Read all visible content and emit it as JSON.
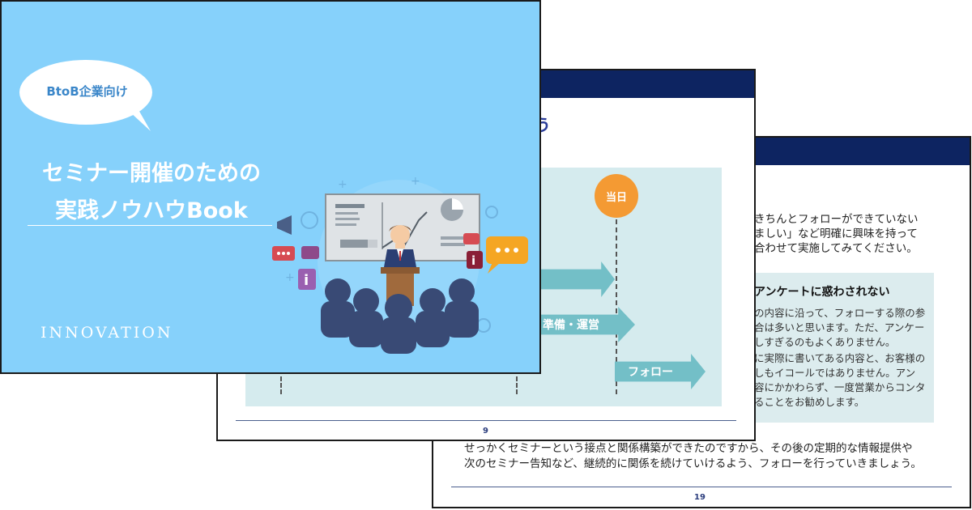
{
  "cover": {
    "badge": "BtoB企業向け",
    "title_line1": "セミナー開催のための",
    "title_line2": "実践ノウハウBook",
    "brand": "INNOVATION"
  },
  "page9": {
    "title_fragment": "う",
    "day_label": "当日",
    "arrows": [
      "",
      "準備・運営",
      "フォロー"
    ],
    "page_number": "9"
  },
  "page19": {
    "lines": [
      "きちんとフォローができていない",
      "ましい」など明確に興味を持って",
      "合わせて実施してみてください。"
    ],
    "box_heading": "アンケートに惑わされない",
    "box_lines": [
      "の内容に沿って、フォローする際の参",
      "合は多いと思います。ただ、アンケー",
      "しすぎるのもよくありません。",
      "に実際に書いてある内容と、お客様の",
      "しもイコールではありません。アン",
      "容にかかわらず、一度営業からコンタ",
      "ることをお勧めします。"
    ],
    "closing_line1": "せっかくセミナーという接点と関係構築ができたのですから、その後の定期的な情報提供や",
    "closing_line2": "次のセミナー告知など、継続的に関係を続けていけるよう、フォローを行っていきましょう。",
    "page_number": "19"
  },
  "colors": {
    "cover_bg": "#86d1fb",
    "navbar": "#0d2461",
    "panel": "#d5ebee",
    "arrow": "#73bfc7",
    "day_circle": "#f49a33"
  }
}
